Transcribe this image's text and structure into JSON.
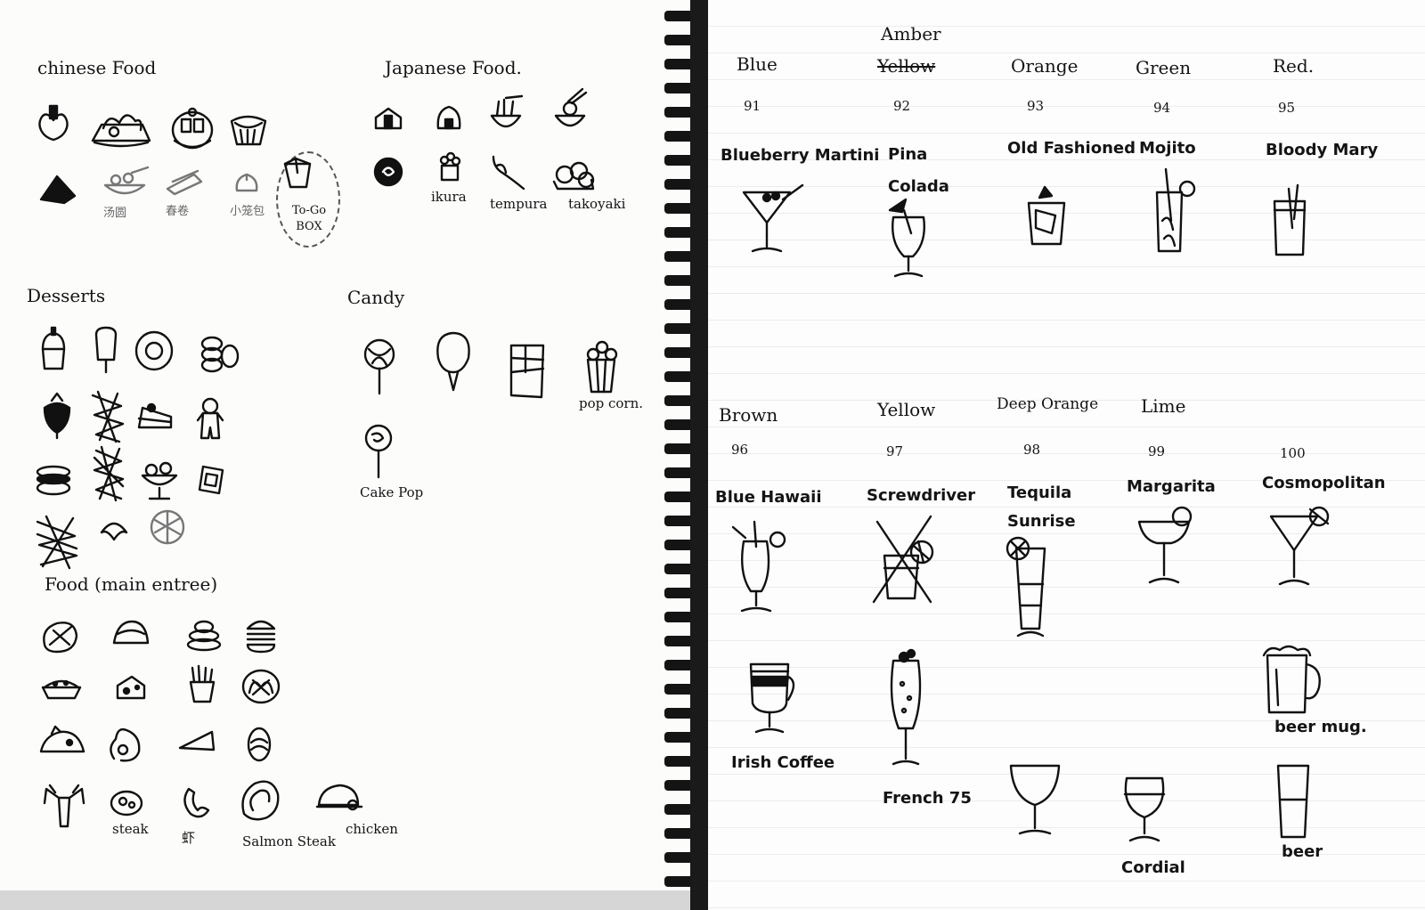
{
  "left": {
    "chinese": {
      "title": "chinese Food",
      "labels": [
        "汤圆",
        "春卷",
        "小笼包",
        "To-Go BOX"
      ]
    },
    "japanese": {
      "title": "Japanese Food.",
      "labels": [
        "ikura",
        "tempura",
        "takoyaki"
      ]
    },
    "desserts": {
      "title": "Desserts"
    },
    "candy": {
      "title": "Candy",
      "labels": [
        "pop corn.",
        "Cake Pop"
      ]
    },
    "main": {
      "title": "Food (main entree)",
      "labels": [
        "steak",
        "虾",
        "Salmon Steak",
        "chicken"
      ]
    }
  },
  "right": {
    "row1": [
      {
        "color": "Blue",
        "num": "91",
        "drink": "Blueberry Martini"
      },
      {
        "color": "Amber",
        "struck": "Yellow",
        "num": "92",
        "drink": "Pina Colada"
      },
      {
        "color": "Orange",
        "num": "93",
        "drink": "Old Fashioned"
      },
      {
        "color": "Green",
        "num": "94",
        "drink": "Mojito"
      },
      {
        "color": "Red.",
        "num": "95",
        "drink": "Bloody Mary"
      }
    ],
    "row2": [
      {
        "color": "Brown",
        "num": "96",
        "drink": "Blue Hawaii"
      },
      {
        "color": "Yellow",
        "num": "97",
        "drink": "Screwdriver"
      },
      {
        "color": "Deep Orange",
        "num": "98",
        "drink": "Tequila Sunrise"
      },
      {
        "color": "Lime",
        "num": "99",
        "drink": "Margarita"
      },
      {
        "num": "100",
        "drink": "Cosmopolitan"
      }
    ],
    "extras": [
      "Irish Coffee",
      "French 75",
      "Cordial",
      "beer mug.",
      "beer"
    ]
  }
}
